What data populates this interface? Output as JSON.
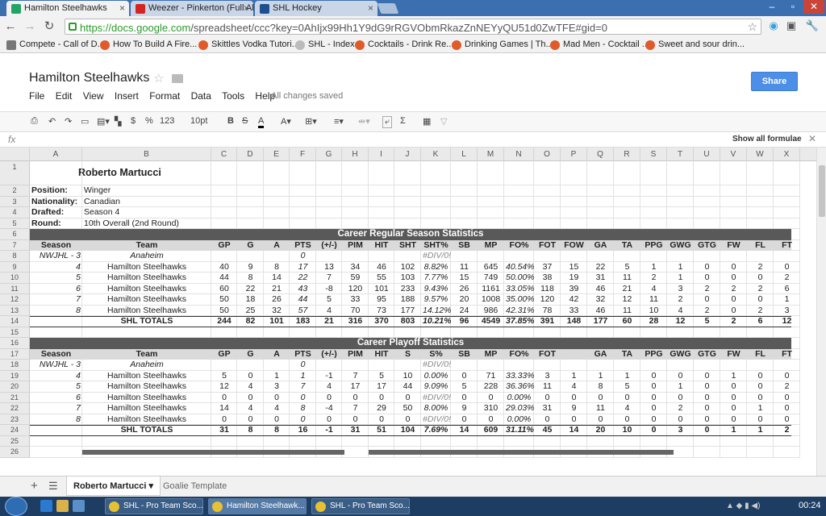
{
  "browser": {
    "tabs": [
      {
        "label": "Hamilton Steelhawks",
        "color": "#21a464"
      },
      {
        "label": "Weezer - Pinkerton (Full Al",
        "color": "#d32323"
      },
      {
        "label": "SHL Hockey",
        "color": "#1d4f91"
      }
    ],
    "window_buttons": [
      "–",
      "▫",
      "✕"
    ],
    "url_host": "https://docs.google.com",
    "url_path": "/spreadsheet/ccc?key=0AhIjx99Hh1Y9dG9rRGVObmRkazZnNEYyQU51d0ZwTFE#gid=0",
    "bookmarks": [
      "Compete - Call of D...",
      "How To Build A Fire...",
      "Skittles Vodka Tutori...",
      "SHL - Index",
      "Cocktails - Drink Re...",
      "Drinking Games | Th...",
      "Mad Men - Cocktail ...",
      "Sweet and sour drin..."
    ]
  },
  "doc": {
    "title": "Hamilton Steelhawks",
    "menus": [
      "File",
      "Edit",
      "View",
      "Insert",
      "Format",
      "Data",
      "Tools",
      "Help"
    ],
    "saved_status": "All changes saved",
    "share_label": "Share",
    "fmt": {
      "currency": "$",
      "percent": "%",
      "number": "123",
      "fontsize": "10pt",
      "bold": "B",
      "sum": "Σ"
    },
    "fx_label": "fx",
    "show_all": "Show all formulae"
  },
  "columns": [
    "A",
    "B",
    "C",
    "D",
    "E",
    "F",
    "G",
    "H",
    "I",
    "J",
    "K",
    "L",
    "M",
    "N",
    "O",
    "P",
    "Q",
    "R",
    "S",
    "T",
    "U",
    "V",
    "W",
    "X"
  ],
  "rows": [
    "1",
    "2",
    "3",
    "4",
    "5",
    "6",
    "7",
    "8",
    "9",
    "10",
    "11",
    "12",
    "13",
    "14",
    "15",
    "16",
    "17",
    "18",
    "19",
    "20",
    "21",
    "22",
    "23",
    "24",
    "25",
    "26"
  ],
  "player": {
    "name": "Roberto Martucci",
    "info": [
      {
        "label": "Position:",
        "value": "Winger"
      },
      {
        "label": "Nationality:",
        "value": "Canadian"
      },
      {
        "label": "Drafted:",
        "value": "Season 4"
      },
      {
        "label": "Round:",
        "value": "10th Overall (2nd Round)"
      }
    ]
  },
  "regular": {
    "title": "Career Regular Season Statistics",
    "headers": [
      "Season",
      "Team",
      "GP",
      "G",
      "A",
      "PTS",
      "(+/-)",
      "PIM",
      "HIT",
      "SHT",
      "SHT%",
      "SB",
      "MP",
      "FO%",
      "FOT",
      "FOW",
      "GA",
      "TA",
      "PPG",
      "GWG",
      "GTG",
      "FW",
      "FL",
      "FT"
    ],
    "rows": [
      [
        "NWJHL - 3",
        "Anaheim",
        "",
        "",
        "",
        "0",
        "",
        "",
        "",
        "",
        "#DIV/0!",
        "",
        "",
        "",
        "",
        "",
        "",
        "",
        "",
        "",
        "",
        "",
        "",
        ""
      ],
      [
        "4",
        "Hamilton Steelhawks",
        "40",
        "9",
        "8",
        "17",
        "13",
        "34",
        "46",
        "102",
        "8.82%",
        "11",
        "645",
        "40.54%",
        "37",
        "15",
        "22",
        "5",
        "1",
        "1",
        "0",
        "0",
        "2",
        "0"
      ],
      [
        "5",
        "Hamilton Steelhawks",
        "44",
        "8",
        "14",
        "22",
        "7",
        "59",
        "55",
        "103",
        "7.77%",
        "15",
        "749",
        "50.00%",
        "38",
        "19",
        "31",
        "11",
        "2",
        "1",
        "0",
        "0",
        "0",
        "2"
      ],
      [
        "6",
        "Hamilton Steelhawks",
        "60",
        "22",
        "21",
        "43",
        "-8",
        "120",
        "101",
        "233",
        "9.43%",
        "26",
        "1161",
        "33.05%",
        "118",
        "39",
        "46",
        "21",
        "4",
        "3",
        "2",
        "2",
        "2",
        "6"
      ],
      [
        "7",
        "Hamilton Steelhawks",
        "50",
        "18",
        "26",
        "44",
        "5",
        "33",
        "95",
        "188",
        "9.57%",
        "20",
        "1008",
        "35.00%",
        "120",
        "42",
        "32",
        "12",
        "11",
        "2",
        "0",
        "0",
        "0",
        "1"
      ],
      [
        "8",
        "Hamilton Steelhawks",
        "50",
        "25",
        "32",
        "57",
        "4",
        "70",
        "73",
        "177",
        "14.12%",
        "24",
        "986",
        "42.31%",
        "78",
        "33",
        "46",
        "11",
        "10",
        "4",
        "2",
        "0",
        "2",
        "3"
      ]
    ],
    "totals": [
      "",
      "SHL TOTALS",
      "244",
      "82",
      "101",
      "183",
      "21",
      "316",
      "370",
      "803",
      "10.21%",
      "96",
      "4549",
      "37.85%",
      "391",
      "148",
      "177",
      "60",
      "28",
      "12",
      "5",
      "2",
      "6",
      "12"
    ]
  },
  "playoff": {
    "title": "Career Playoff Statistics",
    "headers": [
      "Season",
      "Team",
      "GP",
      "G",
      "A",
      "PTS",
      "(+/-)",
      "PIM",
      "HIT",
      "S",
      "S%",
      "SB",
      "MP",
      "FO%",
      "FOT",
      "",
      "GA",
      "TA",
      "PPG",
      "GWG",
      "GTG",
      "FW",
      "FL",
      "FT"
    ],
    "rows": [
      [
        "NWJHL - 3",
        "Anaheim",
        "",
        "",
        "",
        "0",
        "",
        "",
        "",
        "",
        "#DIV/0!",
        "",
        "",
        "",
        "",
        "",
        "",
        "",
        "",
        "",
        "",
        "",
        "",
        ""
      ],
      [
        "4",
        "Hamilton Steelhawks",
        "5",
        "0",
        "1",
        "1",
        "-1",
        "7",
        "5",
        "10",
        "0.00%",
        "0",
        "71",
        "33.33%",
        "3",
        "1",
        "1",
        "1",
        "0",
        "0",
        "0",
        "1",
        "0",
        "0"
      ],
      [
        "5",
        "Hamilton Steelhawks",
        "12",
        "4",
        "3",
        "7",
        "4",
        "17",
        "17",
        "44",
        "9.09%",
        "5",
        "228",
        "36.36%",
        "11",
        "4",
        "8",
        "5",
        "0",
        "1",
        "0",
        "0",
        "0",
        "2"
      ],
      [
        "6",
        "Hamilton Steelhawks",
        "0",
        "0",
        "0",
        "0",
        "0",
        "0",
        "0",
        "0",
        "#DIV/0!",
        "0",
        "0",
        "0.00%",
        "0",
        "0",
        "0",
        "0",
        "0",
        "0",
        "0",
        "0",
        "0",
        "0"
      ],
      [
        "7",
        "Hamilton Steelhawks",
        "14",
        "4",
        "4",
        "8",
        "-4",
        "7",
        "29",
        "50",
        "8.00%",
        "9",
        "310",
        "29.03%",
        "31",
        "9",
        "11",
        "4",
        "0",
        "2",
        "0",
        "0",
        "1",
        "0"
      ],
      [
        "8",
        "Hamilton Steelhawks",
        "0",
        "0",
        "0",
        "0",
        "0",
        "0",
        "0",
        "0",
        "#DIV/0!",
        "0",
        "0",
        "0.00%",
        "0",
        "0",
        "0",
        "0",
        "0",
        "0",
        "0",
        "0",
        "0",
        "0"
      ]
    ],
    "totals": [
      "",
      "SHL TOTALS",
      "31",
      "8",
      "8",
      "16",
      "-1",
      "31",
      "51",
      "104",
      "7.69%",
      "14",
      "609",
      "31.11%",
      "45",
      "14",
      "20",
      "10",
      "0",
      "3",
      "0",
      "1",
      "1",
      "2"
    ]
  },
  "sheet_tabs": [
    "Roberto Martucci",
    "Goalie Template"
  ],
  "taskbar": {
    "tasks": [
      "SHL - Pro Team Sco...",
      "Hamilton Steelhawk...",
      "SHL - Pro Team Sco..."
    ],
    "clock": "00:24"
  }
}
